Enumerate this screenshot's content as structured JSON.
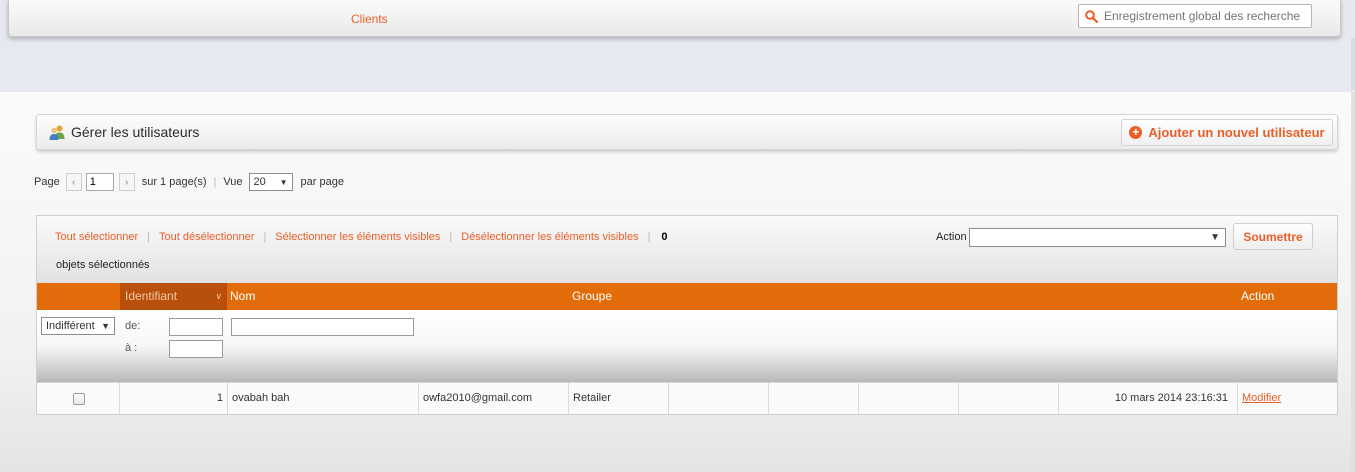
{
  "header": {
    "nav_clients": "Clients",
    "search_placeholder": "Enregistrement global des recherche"
  },
  "page": {
    "title": "Gérer les utilisateurs",
    "add_button": "Ajouter un nouvel utilisateur"
  },
  "pager": {
    "page_label": "Page",
    "current_page": "1",
    "of_pages": "sur 1 page(s)",
    "view_label": "Vue",
    "per_page": "20",
    "per_page_suffix": "par page"
  },
  "massaction": {
    "select_all": "Tout sélectionner",
    "unselect_all": "Tout désélectionner",
    "select_visible": "Sélectionner les éléments visibles",
    "unselect_visible": "Désélectionner les éléments visibles",
    "count": "0",
    "caption": "objets sélectionnés",
    "action_label": "Action",
    "submit": "Soumettre"
  },
  "grid": {
    "columns": {
      "id": "Identifiant",
      "name": "Nom",
      "group": "Groupe",
      "action": "Action"
    },
    "filters": {
      "any": "Indifférent",
      "from_label": "de:",
      "to_label": "à :"
    },
    "rows": [
      {
        "id": "1",
        "name": "ovabah bah",
        "email": "owfa2010@gmail.com",
        "group": "Retailer",
        "date": "10 mars 2014 23:16:31",
        "action": "Modifier"
      }
    ]
  },
  "colors": {
    "accent": "#eb5e28",
    "header_orange": "#e36c0a",
    "sorted_column": "#b8500b"
  }
}
